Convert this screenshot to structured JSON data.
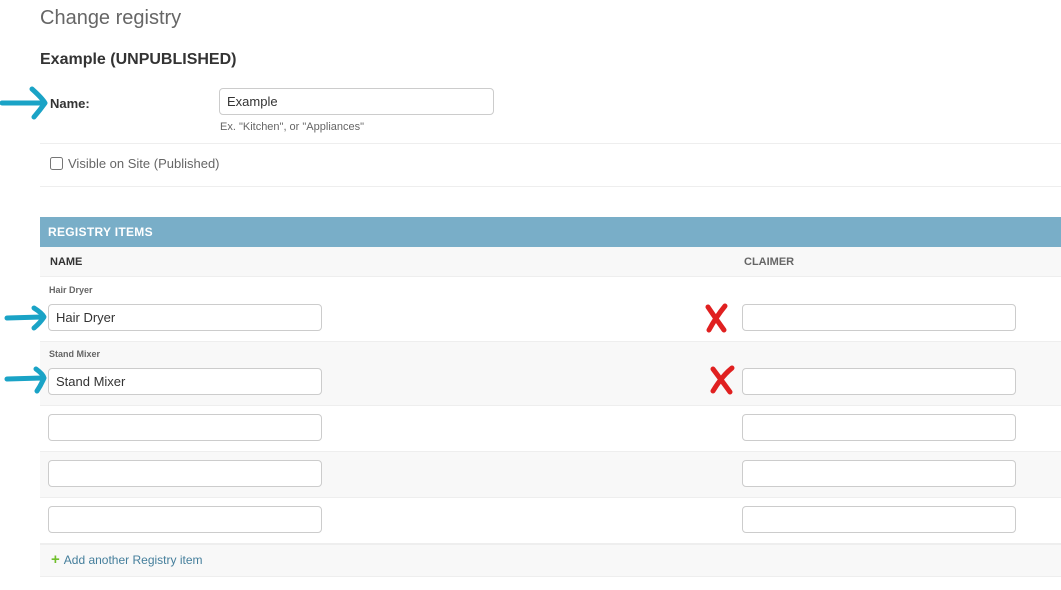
{
  "page": {
    "title": "Change registry",
    "object_title": "Example (UNPUBLISHED)"
  },
  "form": {
    "name_label": "Name:",
    "name_value": "Example",
    "name_help": "Ex. \"Kitchen\", or \"Appliances\"",
    "visible_label": "Visible on Site (Published)",
    "visible_checked": false
  },
  "inline": {
    "header": "REGISTRY ITEMS",
    "columns": [
      "NAME",
      "CLAIMER"
    ],
    "rows": [
      {
        "label": "Hair Dryer",
        "name": "Hair Dryer",
        "claimer": ""
      },
      {
        "label": "Stand Mixer",
        "name": "Stand Mixer",
        "claimer": ""
      },
      {
        "label": "",
        "name": "",
        "claimer": ""
      },
      {
        "label": "",
        "name": "",
        "claimer": ""
      },
      {
        "label": "",
        "name": "",
        "claimer": ""
      }
    ],
    "add_link": "Add another Registry item",
    "add_icon": "plus-icon"
  },
  "annotations": {
    "arrow_color": "#1aa3c6",
    "x_mark_color": "#e02020",
    "arrows": [
      "name-field",
      "row-1-name",
      "row-2-name"
    ],
    "x_marks": [
      "row-1-claimer",
      "row-2-claimer"
    ]
  },
  "colors": {
    "module_header": "#79aec8",
    "link": "#447e9b",
    "add_icon": "#70bf2b",
    "alt_row": "#f8f8f8"
  }
}
